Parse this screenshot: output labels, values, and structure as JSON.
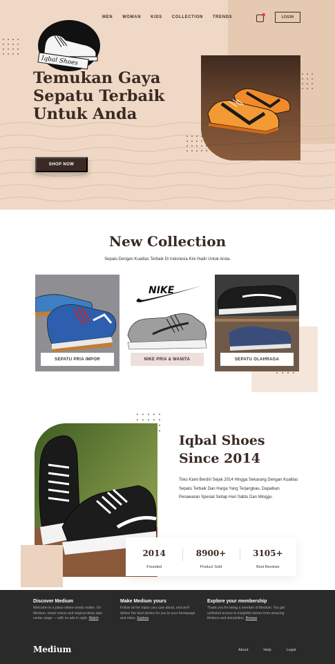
{
  "nav": {
    "items": [
      "MEN",
      "WOMAN",
      "KIDS",
      "COLLECTION",
      "TRENDS"
    ],
    "login_label": "LOGIN"
  },
  "logo": {
    "text": "Iqbal Shoes"
  },
  "hero": {
    "title": "Temukan Gaya Sepatu Terbaik Untuk Anda",
    "cta_label": "SHOP NOW"
  },
  "collection": {
    "title": "New Collection",
    "subtitle": "Sepatu Dengan Kualitas Terbaik Di Indonesia Kini Hadir Untuk Anda.",
    "cards": [
      {
        "label": "SEPATU PRIA IMPOR"
      },
      {
        "label": "NIKE PRIA & WANITA",
        "brand_text": "NIKE"
      },
      {
        "label": "SEPATU OLAHRAGA"
      }
    ]
  },
  "about": {
    "title_line1": "Iqbal Shoes",
    "title_line2": "Since 2014",
    "text": "Toko Kami Berdiri Sejak 2014 Hingga Sekarang Dengan Kualitas Sepatu Terbaik Dan Harga Yang Terjangkau, Dapatkan Penawaran Spesial Setiap Hari Sabtu Dan Minggu.",
    "stats": [
      {
        "value": "2014",
        "label": "Founded"
      },
      {
        "value": "8900+",
        "label": "Product Sold"
      },
      {
        "value": "3105+",
        "label": "Best Reviews"
      }
    ]
  },
  "footer": {
    "columns": [
      {
        "title": "Discover Medium",
        "text": "Welcome to a place where words matter. On Medium, smart voices and original ideas take center stage — with no ads in sight.",
        "link": "Watch"
      },
      {
        "title": "Make Medium yours",
        "text": "Follow all the topics you care about, and we'll deliver the best stories for you to your homepage and inbox.",
        "link": "Explore"
      },
      {
        "title": "Explore your membership",
        "text": "Thank you for being a member of Medium. You get unlimited access to insightful stories from amazing thinkers and storytellers.",
        "link": "Browse"
      }
    ],
    "brand": "Medium",
    "links": [
      "About",
      "Help",
      "Legal"
    ]
  },
  "colors": {
    "hero_bg": "#efd9c6",
    "accent_dark": "#3a2a24",
    "footer_bg": "#2a2a2a"
  },
  "icons": {
    "cart": "cart-icon"
  }
}
